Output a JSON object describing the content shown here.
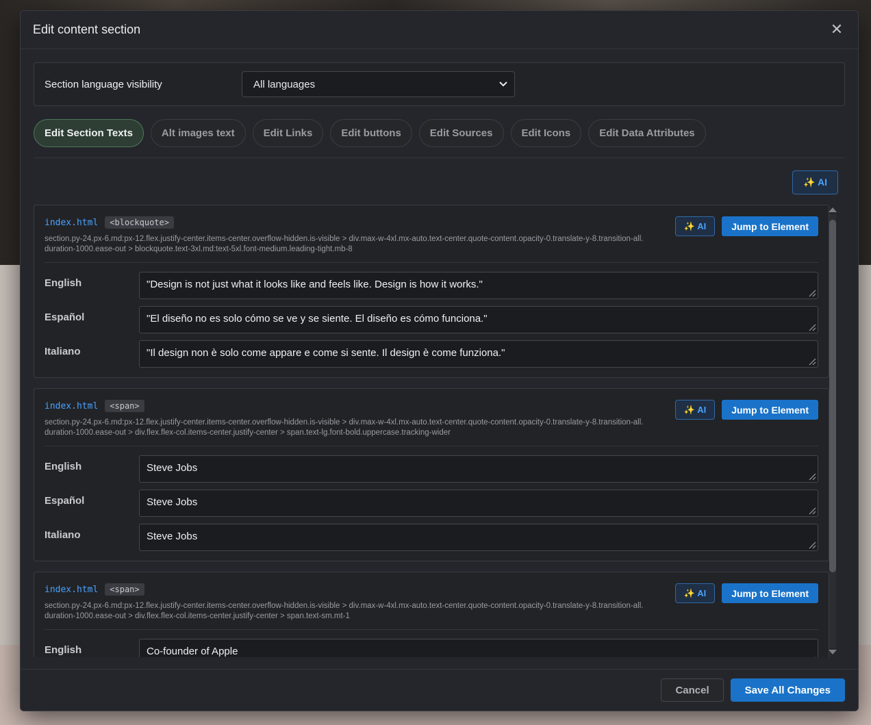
{
  "modal": {
    "title": "Edit content section"
  },
  "language_visibility": {
    "label": "Section language visibility",
    "selected": "All languages"
  },
  "tabs": [
    {
      "label": "Edit Section Texts"
    },
    {
      "label": "Alt images text"
    },
    {
      "label": "Edit Links"
    },
    {
      "label": "Edit buttons"
    },
    {
      "label": "Edit Sources"
    },
    {
      "label": "Edit Icons"
    },
    {
      "label": "Edit Data Attributes"
    }
  ],
  "ai_label": "✨ AI",
  "jump_label": "Jump to Element",
  "cards": [
    {
      "file": "index.html",
      "tag": "<blockquote>",
      "selector": "section.py-24.px-6.md:px-12.flex.justify-center.items-center.overflow-hidden.is-visible > div.max-w-4xl.mx-auto.text-center.quote-content.opacity-0.translate-y-8.transition-all.duration-1000.ease-out > blockquote.text-3xl.md:text-5xl.font-medium.leading-tight.mb-8",
      "fields": [
        {
          "lang": "English",
          "value": "\"Design is not just what it looks like and feels like. Design is how it works.\""
        },
        {
          "lang": "Español",
          "value": "\"El diseño no es solo cómo se ve y se siente. El diseño es cómo funciona.\""
        },
        {
          "lang": "Italiano",
          "value": "\"Il design non è solo come appare e come si sente. Il design è come funziona.\""
        }
      ]
    },
    {
      "file": "index.html",
      "tag": "<span>",
      "selector": "section.py-24.px-6.md:px-12.flex.justify-center.items-center.overflow-hidden.is-visible > div.max-w-4xl.mx-auto.text-center.quote-content.opacity-0.translate-y-8.transition-all.duration-1000.ease-out > div.flex.flex-col.items-center.justify-center > span.text-lg.font-bold.uppercase.tracking-wider",
      "fields": [
        {
          "lang": "English",
          "value": "Steve Jobs"
        },
        {
          "lang": "Español",
          "value": "Steve Jobs"
        },
        {
          "lang": "Italiano",
          "value": "Steve Jobs"
        }
      ]
    },
    {
      "file": "index.html",
      "tag": "<span>",
      "selector": "section.py-24.px-6.md:px-12.flex.justify-center.items-center.overflow-hidden.is-visible > div.max-w-4xl.mx-auto.text-center.quote-content.opacity-0.translate-y-8.transition-all.duration-1000.ease-out > div.flex.flex-col.items-center.justify-center > span.text-sm.mt-1",
      "fields": [
        {
          "lang": "English",
          "value": "Co-founder of Apple"
        }
      ]
    }
  ],
  "footer": {
    "cancel_label": "Cancel",
    "save_label": "Save All Changes"
  }
}
